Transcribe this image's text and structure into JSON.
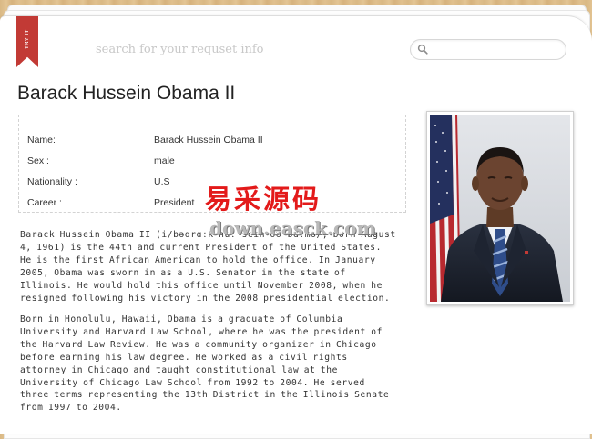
{
  "ribbon": {
    "label": "TRY IT"
  },
  "search": {
    "hint": "search for your requset info",
    "placeholder": ""
  },
  "person": {
    "title": "Barack Hussein Obama II",
    "fields": [
      {
        "label": "Name:",
        "value": "Barack Hussein Obama II"
      },
      {
        "label": "Sex :",
        "value": "male"
      },
      {
        "label": "Nationality :",
        "value": "U.S"
      },
      {
        "label": "Career :",
        "value": "President"
      }
    ],
    "bio": [
      "Barack Hussein Obama II (i/bəɑrɑːk huːˈseɪn oʊˈbɑːmə/; born August 4, 1961) is the 44th and current President of the United States. He is the first African American to hold the office. In January 2005, Obama was sworn in as a U.S. Senator in the state of Illinois. He would hold this office until November 2008, when he resigned following his victory in the 2008 presidential election.",
      "Born in Honolulu, Hawaii, Obama is a graduate of Columbia University and Harvard Law School, where he was the president of the Harvard Law Review. He was a community organizer in Chicago before earning his law degree. He worked as a civil rights attorney in Chicago and taught constitutional law at the University of Chicago Law School from 1992 to 2004. He served three terms representing the 13th District in the Illinois Senate from 1997 to 2004."
    ]
  },
  "watermark": {
    "chinese": "易采源码",
    "url": "down.easck.com"
  },
  "colors": {
    "ribbon": "#c23a35",
    "watermark": "#e31a1a",
    "wood": "#dcbc88"
  }
}
